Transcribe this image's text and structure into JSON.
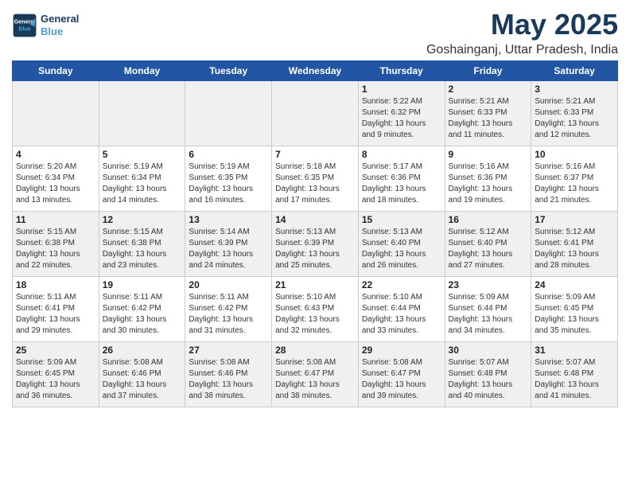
{
  "header": {
    "logo_line1": "General",
    "logo_line2": "Blue",
    "month": "May 2025",
    "location": "Goshainganj, Uttar Pradesh, India"
  },
  "weekdays": [
    "Sunday",
    "Monday",
    "Tuesday",
    "Wednesday",
    "Thursday",
    "Friday",
    "Saturday"
  ],
  "weeks": [
    [
      {
        "day": "",
        "info": ""
      },
      {
        "day": "",
        "info": ""
      },
      {
        "day": "",
        "info": ""
      },
      {
        "day": "",
        "info": ""
      },
      {
        "day": "1",
        "info": "Sunrise: 5:22 AM\nSunset: 6:32 PM\nDaylight: 13 hours\nand 9 minutes."
      },
      {
        "day": "2",
        "info": "Sunrise: 5:21 AM\nSunset: 6:33 PM\nDaylight: 13 hours\nand 11 minutes."
      },
      {
        "day": "3",
        "info": "Sunrise: 5:21 AM\nSunset: 6:33 PM\nDaylight: 13 hours\nand 12 minutes."
      }
    ],
    [
      {
        "day": "4",
        "info": "Sunrise: 5:20 AM\nSunset: 6:34 PM\nDaylight: 13 hours\nand 13 minutes."
      },
      {
        "day": "5",
        "info": "Sunrise: 5:19 AM\nSunset: 6:34 PM\nDaylight: 13 hours\nand 14 minutes."
      },
      {
        "day": "6",
        "info": "Sunrise: 5:19 AM\nSunset: 6:35 PM\nDaylight: 13 hours\nand 16 minutes."
      },
      {
        "day": "7",
        "info": "Sunrise: 5:18 AM\nSunset: 6:35 PM\nDaylight: 13 hours\nand 17 minutes."
      },
      {
        "day": "8",
        "info": "Sunrise: 5:17 AM\nSunset: 6:36 PM\nDaylight: 13 hours\nand 18 minutes."
      },
      {
        "day": "9",
        "info": "Sunrise: 5:16 AM\nSunset: 6:36 PM\nDaylight: 13 hours\nand 19 minutes."
      },
      {
        "day": "10",
        "info": "Sunrise: 5:16 AM\nSunset: 6:37 PM\nDaylight: 13 hours\nand 21 minutes."
      }
    ],
    [
      {
        "day": "11",
        "info": "Sunrise: 5:15 AM\nSunset: 6:38 PM\nDaylight: 13 hours\nand 22 minutes."
      },
      {
        "day": "12",
        "info": "Sunrise: 5:15 AM\nSunset: 6:38 PM\nDaylight: 13 hours\nand 23 minutes."
      },
      {
        "day": "13",
        "info": "Sunrise: 5:14 AM\nSunset: 6:39 PM\nDaylight: 13 hours\nand 24 minutes."
      },
      {
        "day": "14",
        "info": "Sunrise: 5:13 AM\nSunset: 6:39 PM\nDaylight: 13 hours\nand 25 minutes."
      },
      {
        "day": "15",
        "info": "Sunrise: 5:13 AM\nSunset: 6:40 PM\nDaylight: 13 hours\nand 26 minutes."
      },
      {
        "day": "16",
        "info": "Sunrise: 5:12 AM\nSunset: 6:40 PM\nDaylight: 13 hours\nand 27 minutes."
      },
      {
        "day": "17",
        "info": "Sunrise: 5:12 AM\nSunset: 6:41 PM\nDaylight: 13 hours\nand 28 minutes."
      }
    ],
    [
      {
        "day": "18",
        "info": "Sunrise: 5:11 AM\nSunset: 6:41 PM\nDaylight: 13 hours\nand 29 minutes."
      },
      {
        "day": "19",
        "info": "Sunrise: 5:11 AM\nSunset: 6:42 PM\nDaylight: 13 hours\nand 30 minutes."
      },
      {
        "day": "20",
        "info": "Sunrise: 5:11 AM\nSunset: 6:42 PM\nDaylight: 13 hours\nand 31 minutes."
      },
      {
        "day": "21",
        "info": "Sunrise: 5:10 AM\nSunset: 6:43 PM\nDaylight: 13 hours\nand 32 minutes."
      },
      {
        "day": "22",
        "info": "Sunrise: 5:10 AM\nSunset: 6:44 PM\nDaylight: 13 hours\nand 33 minutes."
      },
      {
        "day": "23",
        "info": "Sunrise: 5:09 AM\nSunset: 6:44 PM\nDaylight: 13 hours\nand 34 minutes."
      },
      {
        "day": "24",
        "info": "Sunrise: 5:09 AM\nSunset: 6:45 PM\nDaylight: 13 hours\nand 35 minutes."
      }
    ],
    [
      {
        "day": "25",
        "info": "Sunrise: 5:09 AM\nSunset: 6:45 PM\nDaylight: 13 hours\nand 36 minutes."
      },
      {
        "day": "26",
        "info": "Sunrise: 5:08 AM\nSunset: 6:46 PM\nDaylight: 13 hours\nand 37 minutes."
      },
      {
        "day": "27",
        "info": "Sunrise: 5:08 AM\nSunset: 6:46 PM\nDaylight: 13 hours\nand 38 minutes."
      },
      {
        "day": "28",
        "info": "Sunrise: 5:08 AM\nSunset: 6:47 PM\nDaylight: 13 hours\nand 38 minutes."
      },
      {
        "day": "29",
        "info": "Sunrise: 5:08 AM\nSunset: 6:47 PM\nDaylight: 13 hours\nand 39 minutes."
      },
      {
        "day": "30",
        "info": "Sunrise: 5:07 AM\nSunset: 6:48 PM\nDaylight: 13 hours\nand 40 minutes."
      },
      {
        "day": "31",
        "info": "Sunrise: 5:07 AM\nSunset: 6:48 PM\nDaylight: 13 hours\nand 41 minutes."
      }
    ]
  ],
  "row_styles": [
    "shaded",
    "white",
    "shaded",
    "white",
    "shaded"
  ]
}
